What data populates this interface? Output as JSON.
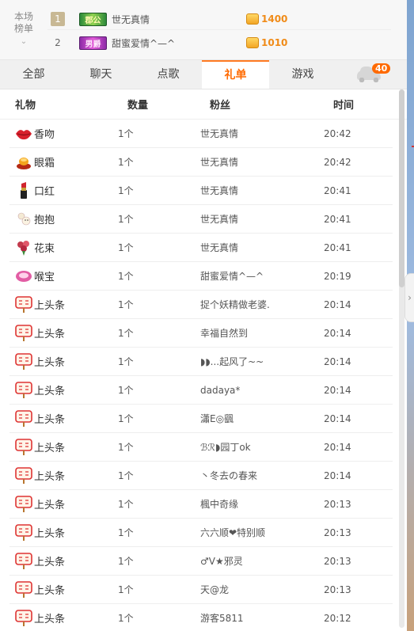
{
  "ranking": {
    "label_line1": "本场",
    "label_line2": "榜单",
    "entries": [
      {
        "rank": "1",
        "medal": "郡公",
        "name": "世无真情",
        "coins": "1400"
      },
      {
        "rank": "2",
        "medal": "男爵",
        "name": "甜蜜爱情^—^",
        "coins": "1010"
      }
    ]
  },
  "tabs": [
    "全部",
    "聊天",
    "点歌",
    "礼单",
    "游戏"
  ],
  "car_badge": "40",
  "table": {
    "headers": [
      "礼物",
      "数量",
      "粉丝",
      "时间"
    ],
    "rows": [
      {
        "gift": "香吻",
        "icon": "lips-icon",
        "qty": "1个",
        "fan": "世无真情",
        "time": "20:42"
      },
      {
        "gift": "眼霜",
        "icon": "cream-icon",
        "qty": "1个",
        "fan": "世无真情",
        "time": "20:42"
      },
      {
        "gift": "口红",
        "icon": "lipstick-icon",
        "qty": "1个",
        "fan": "世无真情",
        "time": "20:41"
      },
      {
        "gift": "抱抱",
        "icon": "hug-icon",
        "qty": "1个",
        "fan": "世无真情",
        "time": "20:41"
      },
      {
        "gift": "花束",
        "icon": "bouquet-icon",
        "qty": "1个",
        "fan": "世无真情",
        "time": "20:41"
      },
      {
        "gift": "喉宝",
        "icon": "lozenge-icon",
        "qty": "1个",
        "fan": "甜蜜爱情^—^",
        "time": "20:19"
      },
      {
        "gift": "上头条",
        "icon": "headline-sign-icon",
        "qty": "1个",
        "fan": "捉个妖精做老婆.",
        "time": "20:14"
      },
      {
        "gift": "上头条",
        "icon": "headline-sign-icon",
        "qty": "1个",
        "fan": "幸福自然到",
        "time": "20:14"
      },
      {
        "gift": "上头条",
        "icon": "headline-sign-icon",
        "qty": "1个",
        "fan": "◗◗...起风了~~",
        "time": "20:14"
      },
      {
        "gift": "上头条",
        "icon": "headline-sign-icon",
        "qty": "1个",
        "fan": "dadaya*",
        "time": "20:14"
      },
      {
        "gift": "上头条",
        "icon": "headline-sign-icon",
        "qty": "1个",
        "fan": "瀟E◎颻",
        "time": "20:14"
      },
      {
        "gift": "上头条",
        "icon": "headline-sign-icon",
        "qty": "1个",
        "fan": "ℬℛ◗园丁ok",
        "time": "20:14"
      },
      {
        "gift": "上头条",
        "icon": "headline-sign-icon",
        "qty": "1个",
        "fan": "丶冬去の春来",
        "time": "20:14"
      },
      {
        "gift": "上头条",
        "icon": "headline-sign-icon",
        "qty": "1个",
        "fan": "楓中奇缘",
        "time": "20:13"
      },
      {
        "gift": "上头条",
        "icon": "headline-sign-icon",
        "qty": "1个",
        "fan": "六六顺❤特别顺",
        "time": "20:13"
      },
      {
        "gift": "上头条",
        "icon": "headline-sign-icon",
        "qty": "1个",
        "fan": "♂V★邪灵",
        "time": "20:13"
      },
      {
        "gift": "上头条",
        "icon": "headline-sign-icon",
        "qty": "1个",
        "fan": "天@龙",
        "time": "20:13"
      },
      {
        "gift": "上头条",
        "icon": "headline-sign-icon",
        "qty": "1个",
        "fan": "游客5811",
        "time": "20:12"
      }
    ]
  }
}
